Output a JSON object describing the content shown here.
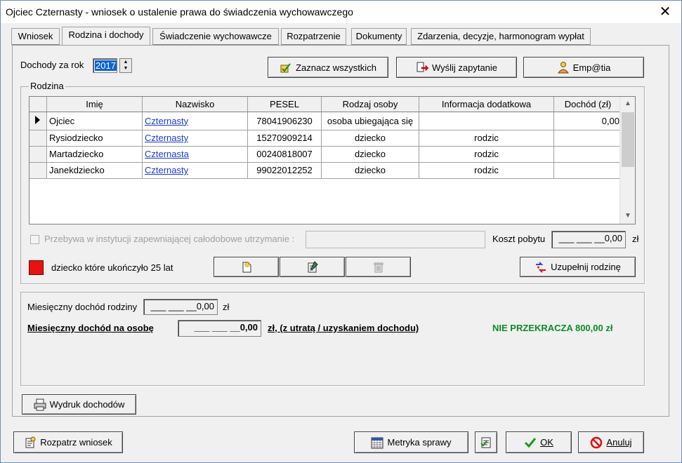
{
  "window": {
    "title": "Ojciec Czternasty - wniosek o ustalenie prawa do świadczenia wychowawczego",
    "close_glyph": "✕"
  },
  "tabs": [
    {
      "label": "Wniosek"
    },
    {
      "label": "Rodzina i dochody",
      "active": true
    },
    {
      "label": "Świadczenie wychowawcze"
    },
    {
      "label": "Rozpatrzenie"
    },
    {
      "label": "Dokumenty"
    },
    {
      "label": "Zdarzenia, decyzje, harmonogram wypłat"
    }
  ],
  "income_year": {
    "label": "Dochody za rok",
    "value": "2017"
  },
  "toolbar": {
    "select_all": "Zaznacz wszystkich",
    "send_query": "Wyślij zapytanie",
    "empatia": "Emp@tia"
  },
  "family": {
    "group_label": "Rodzina",
    "columns": [
      "Imię",
      "Nazwisko",
      "PESEL",
      "Rodzaj osoby",
      "Informacja dodatkowa",
      "Dochód (zł)"
    ],
    "rows": [
      {
        "imie": "Ojciec",
        "nazwisko": "Czternasty",
        "pesel": "78041906230",
        "rodzaj": "osoba ubiegająca się",
        "info": "",
        "dochod": "0,00",
        "current": true
      },
      {
        "imie": "Rysiodziecko",
        "nazwisko": "Czternasty",
        "pesel": "15270909214",
        "rodzaj": "dziecko",
        "info": "rodzic",
        "dochod": ""
      },
      {
        "imie": "Martadziecko",
        "nazwisko": "Czternasta",
        "pesel": "00240818007",
        "rodzaj": "dziecko",
        "info": "rodzic",
        "dochod": ""
      },
      {
        "imie": "Janekdziecko",
        "nazwisko": "Czternasty",
        "pesel": "99022012252",
        "rodzaj": "dziecko",
        "info": "rodzic",
        "dochod": ""
      }
    ],
    "institution_label": "Przebywa w instytucji zapewniającej całodobowe utrzymanie :",
    "cost_label": "Koszt pobytu",
    "cost_value": "___ ___ __0,00",
    "cost_unit": "zł",
    "legend_text": "dziecko które ukończyło 25 lat",
    "legend_color": "#e81212",
    "complete_family": "Uzupełnij rodzinę"
  },
  "income": {
    "monthly_family_label": "Miesięczny dochód rodziny",
    "monthly_family_value": "___ ___ __0,00",
    "monthly_family_unit": "zł",
    "per_person_label": "Miesięczny dochód na osobę",
    "per_person_value": "___ ___ __0,00",
    "per_person_suffix": "zł, (z utratą / uzyskaniem dochodu)",
    "status": "NIE PRZEKRACZA 800,00 zł",
    "status_color": "#0f8a2a"
  },
  "buttons": {
    "print_income": "Wydruk dochodów",
    "examine": "Rozpatrz wniosek",
    "metrics": "Metryka sprawy",
    "ok": "OK",
    "cancel": "Anuluj"
  }
}
